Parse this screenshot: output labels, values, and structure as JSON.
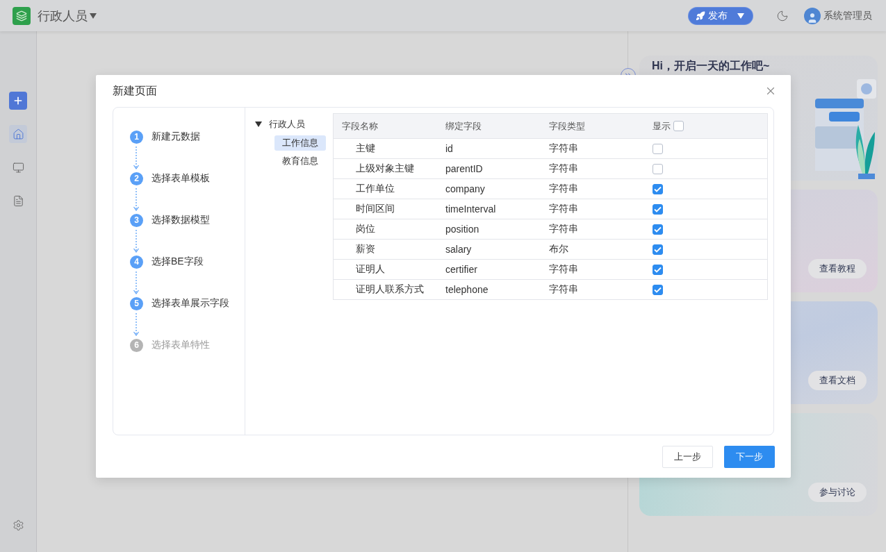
{
  "top_bar": {
    "app_name": "行政人员",
    "publish_button": "发布",
    "user_name": "系统管理员"
  },
  "sidebar": {
    "items": [
      {
        "kind": "home",
        "selected": true
      },
      {
        "kind": "monitor",
        "selected": false
      },
      {
        "kind": "report",
        "selected": false
      }
    ]
  },
  "right_panel": {
    "greeting": "Hi，开启一天的工作吧~",
    "cards": [
      {
        "kind": "tutorial",
        "button": "查看教程"
      },
      {
        "kind": "docs",
        "button": "查看文档"
      },
      {
        "kind": "discuss",
        "button": "参与讨论"
      }
    ]
  },
  "dialog": {
    "title": "新建页面",
    "steps": [
      {
        "number": "1",
        "label": "新建元数据",
        "disabled": false
      },
      {
        "number": "2",
        "label": "选择表单模板",
        "disabled": false
      },
      {
        "number": "3",
        "label": "选择数据模型",
        "disabled": false
      },
      {
        "number": "4",
        "label": "选择BE字段",
        "disabled": false
      },
      {
        "number": "5",
        "label": "选择表单展示字段",
        "disabled": false
      },
      {
        "number": "6",
        "label": "选择表单特性",
        "disabled": true
      }
    ],
    "tree": {
      "label": "行政人员",
      "expanded": true,
      "children": [
        {
          "label": "工作信息",
          "selected": true
        },
        {
          "label": "教育信息",
          "selected": false
        }
      ]
    },
    "table": {
      "columns": [
        "字段名称",
        "绑定字段",
        "字段类型"
      ],
      "show_column": {
        "label": "显示",
        "checked": false
      },
      "rows": [
        {
          "name": "主键",
          "field": "id",
          "type": "字符串",
          "checked": false
        },
        {
          "name": "上级对象主键",
          "field": "parentID",
          "type": "字符串",
          "checked": false
        },
        {
          "name": "工作单位",
          "field": "company",
          "type": "字符串",
          "checked": true
        },
        {
          "name": "时间区间",
          "field": "timeInterval",
          "type": "字符串",
          "checked": true
        },
        {
          "name": "岗位",
          "field": "position",
          "type": "字符串",
          "checked": true
        },
        {
          "name": "薪资",
          "field": "salary",
          "type": "布尔",
          "checked": true
        },
        {
          "name": "证明人",
          "field": "certifier",
          "type": "字符串",
          "checked": true
        },
        {
          "name": "证明人联系方式",
          "field": "telephone",
          "type": "字符串",
          "checked": true
        }
      ]
    },
    "buttons": {
      "previous": "上一步",
      "next": "下一步"
    }
  }
}
